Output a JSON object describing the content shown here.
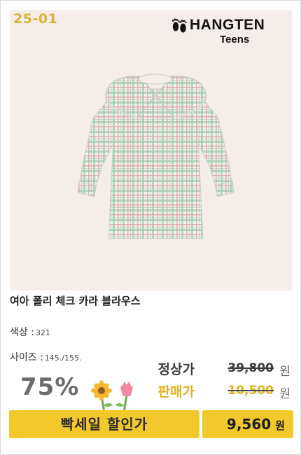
{
  "badge": {
    "code": "25-01"
  },
  "brand": {
    "name": "HANGTEN",
    "sub": "Teens"
  },
  "product": {
    "title": "여아 폴리 체크 카라 블라우스",
    "color_label": "색상 :",
    "color_value": "321",
    "size_label": "사이즈 :",
    "size_value": "145./155."
  },
  "pricing": {
    "discount": "75%",
    "regular_label": "정상가",
    "regular_price": "39,800",
    "sale_label": "판매가",
    "sale_price": "10,500",
    "currency": "원"
  },
  "banner": {
    "label": "빡세일 할인가",
    "final_price": "9,560",
    "currency": "원"
  },
  "colors": {
    "accent": "#f3c82b",
    "code": "#d8b233",
    "hero_bg": "#f4edea"
  },
  "icons": [
    "footprints-icon",
    "flowers-icon"
  ]
}
